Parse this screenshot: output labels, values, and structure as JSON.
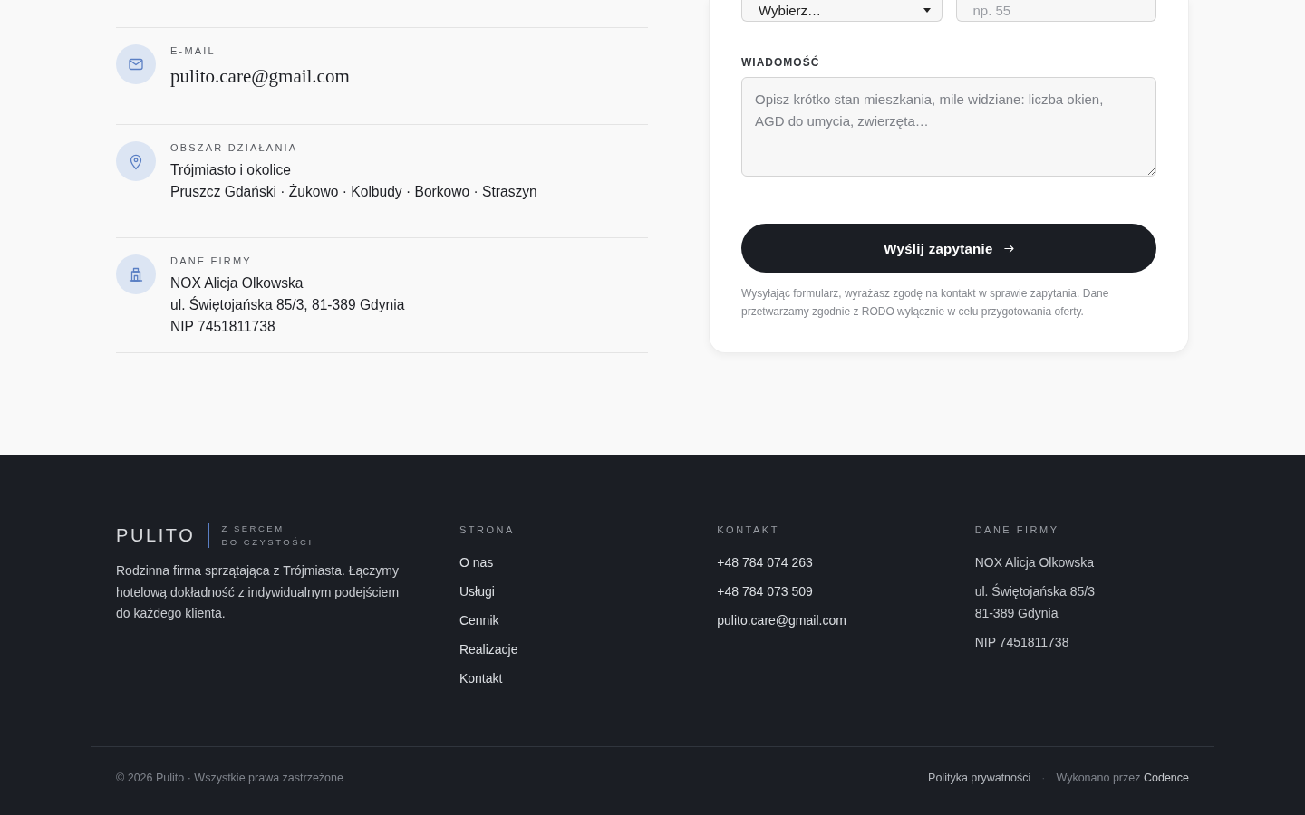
{
  "contact_items": [
    {
      "kind": "email",
      "label": "E-MAIL",
      "lines": [
        "pulito.care@gmail.com"
      ]
    },
    {
      "kind": "area",
      "label": "OBSZAR DZIAŁANIA",
      "lines": [
        "Trójmiasto i okolice",
        "Pruszcz Gdański · Żukowo · Kolbudy · Borkowo · Straszyn"
      ]
    },
    {
      "kind": "company",
      "label": "DANE FIRMY",
      "lines": [
        "NOX Alicja Olkowska",
        "ul. Świętojańska 85/3, 81-389 Gdynia",
        "NIP 7451811738"
      ]
    }
  ],
  "form": {
    "fields": [
      {
        "kind": "select",
        "value": "Wybierz…"
      },
      {
        "kind": "input",
        "placeholder": "np. 55"
      }
    ],
    "message": {
      "label": "WIADOMOŚĆ",
      "placeholder": "Opisz krótko stan mieszkania, mile widziane: liczba okien, AGD do umycia, zwierzęta…"
    },
    "submit": "Wyślij zapytanie",
    "consent": "Wysyłając formularz, wyrażasz zgodę na kontakt w sprawie zapytania. Dane przetwarzamy zgodnie z RODO wyłącznie w celu przygotowania oferty."
  },
  "footer": {
    "brand": {
      "name": "PULITO",
      "tagline": [
        "Z SERCEM",
        "DO CZYSTOŚCI"
      ],
      "description": "Rodzinna firma sprzątająca z Trójmiasta. Łączymy hotelową dokładność z indywidualnym podejściem do każdego klienta."
    },
    "columns": [
      {
        "kind": "links",
        "heading": "STRONA",
        "items": [
          [
            "O nas"
          ],
          [
            "Usługi"
          ],
          [
            "Cennik"
          ],
          [
            "Realizacje"
          ],
          [
            "Kontakt"
          ]
        ]
      },
      {
        "kind": "links",
        "heading": "KONTAKT",
        "items": [
          [
            "+48 784 074 263"
          ],
          [
            "+48 784 073 509"
          ],
          [
            "pulito.care@gmail.com"
          ]
        ]
      },
      {
        "kind": "info",
        "heading": "DANE FIRMY",
        "items": [
          [
            "NOX Alicja Olkowska"
          ],
          [
            "ul. Świętojańska 85/3",
            "81-389 Gdynia"
          ],
          [
            "NIP 7451811738"
          ]
        ]
      }
    ],
    "bottom": {
      "copyright": "© 2026 Pulito · Wszystkie prawa zastrzeżone",
      "policy_link": "Polityka prywatności",
      "separator": "·",
      "credit": {
        "text": "Wykonano przez",
        "link": "Codence"
      }
    }
  }
}
